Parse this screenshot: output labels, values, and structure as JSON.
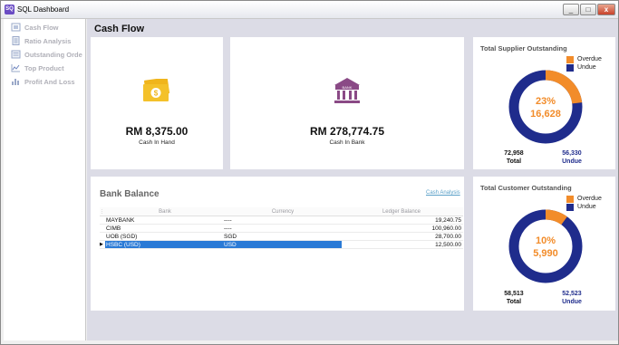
{
  "window": {
    "title": "SQL Dashboard",
    "app_icon_text": "SQ",
    "minimize": "_",
    "maximize": "□",
    "close": "x"
  },
  "sidebar": {
    "items": [
      {
        "label": "Cash Flow",
        "icon": "wallet-icon"
      },
      {
        "label": "Ratio Analysis",
        "icon": "document-icon"
      },
      {
        "label": "Outstanding Orde",
        "icon": "list-icon"
      },
      {
        "label": "Top Product",
        "icon": "line-chart-icon"
      },
      {
        "label": "Profit And Loss",
        "icon": "bar-chart-icon"
      }
    ]
  },
  "page": {
    "title": "Cash Flow"
  },
  "cash_in_hand": {
    "amount": "RM 8,375.00",
    "label": "Cash In Hand",
    "icon": "money-icon"
  },
  "cash_in_bank": {
    "amount": "RM 278,774.75",
    "label": "Cash In Bank",
    "icon": "bank-icon",
    "icon_text": "BANK"
  },
  "supplier": {
    "title": "Total Supplier Outstanding",
    "legend": [
      "Overdue",
      "Undue"
    ],
    "percent": "23%",
    "amount": "16,628",
    "overdue_fraction": 0.23,
    "total_value": "72,958",
    "total_label": "Total",
    "undue_value": "56,330",
    "undue_label": "Undue"
  },
  "customer": {
    "title": "Total Customer Outstanding",
    "legend": [
      "Overdue",
      "Undue"
    ],
    "percent": "10%",
    "amount": "5,990",
    "overdue_fraction": 0.1,
    "total_value": "58,513",
    "total_label": "Total",
    "undue_value": "52,523",
    "undue_label": "Undue"
  },
  "bank_balance": {
    "title": "Bank Balance",
    "link": "Cash Analysis",
    "columns": [
      "Bank",
      "Currency",
      "Ledger Balance"
    ],
    "rows": [
      {
        "bank": "MAYBANK",
        "currency": "----",
        "ledger": "19,240.75"
      },
      {
        "bank": "CIMB",
        "currency": "----",
        "ledger": "100,960.00"
      },
      {
        "bank": "UOB (SGD)",
        "currency": "SGD",
        "ledger": "28,700.00"
      },
      {
        "bank": "HSBC (USD)",
        "currency": "USD",
        "ledger": "12,500.00"
      }
    ],
    "selected_row": 3
  },
  "colors": {
    "overdue": "#f28c2a",
    "undue": "#1f2c8c",
    "selection": "#2a7ad6",
    "money": "#f0b51c",
    "bank": "#8a4a86"
  }
}
